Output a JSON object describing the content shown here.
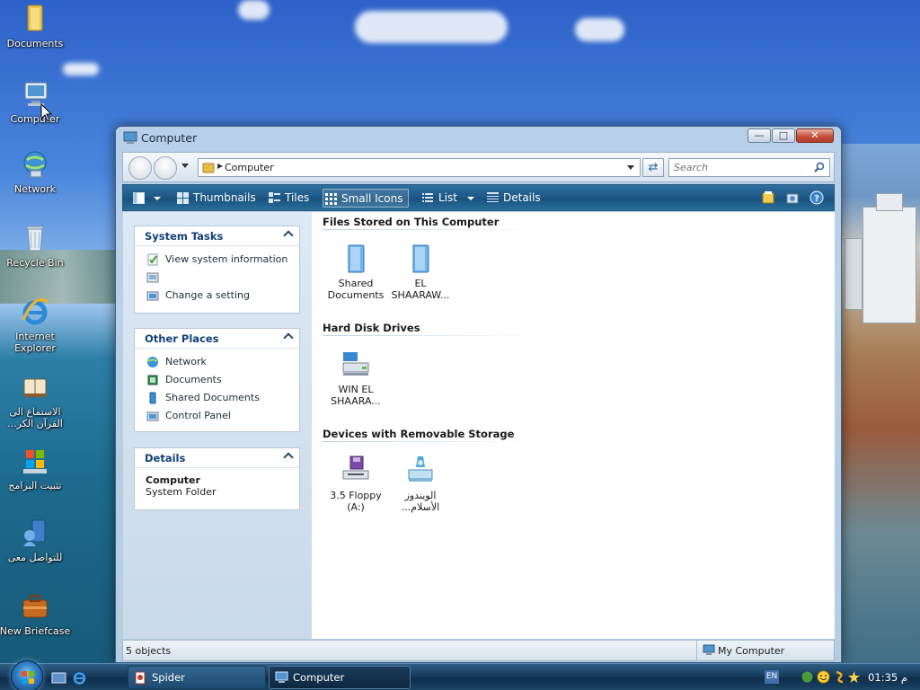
{
  "desktop": {
    "icons": [
      {
        "label": "Documents",
        "icon": "folder-icon"
      },
      {
        "label": "Computer",
        "icon": "computer-icon"
      },
      {
        "label": "Network",
        "icon": "network-icon"
      },
      {
        "label": "Recycle Bin",
        "icon": "recycle-bin-icon"
      },
      {
        "label": "Internet Explorer",
        "icon": "internet-explorer-icon"
      },
      {
        "label": "الاستماع الى القرآن الكر...",
        "icon": "book-icon"
      },
      {
        "label": "تثبيت البرامج",
        "icon": "windows-installer-icon"
      },
      {
        "label": "للتواصل معى",
        "icon": "contact-icon"
      },
      {
        "label": "New Briefcase",
        "icon": "briefcase-icon"
      }
    ]
  },
  "window": {
    "title": "Computer",
    "address": {
      "crumb": "Computer",
      "search_placeholder": "Search"
    },
    "toolbar": {
      "thumbnails": "Thumbnails",
      "tiles": "Tiles",
      "small_icons": "Small Icons",
      "list": "List",
      "details": "Details"
    },
    "panels": {
      "system_tasks": {
        "title": "System Tasks",
        "items": [
          "View system information",
          "Change a setting"
        ]
      },
      "other_places": {
        "title": "Other Places",
        "items": [
          "Network",
          "Documents",
          "Shared Documents",
          "Control Panel"
        ]
      },
      "details": {
        "title": "Details",
        "name": "Computer",
        "type": "System Folder"
      }
    },
    "groups": [
      {
        "title": "Files Stored on This Computer",
        "items": [
          {
            "label": "Shared Documents",
            "icon": "folder-icon"
          },
          {
            "label": "EL SHAARAW...",
            "icon": "folder-icon"
          }
        ]
      },
      {
        "title": "Hard Disk Drives",
        "items": [
          {
            "label": "WIN EL SHAARA...",
            "icon": "hard-disk-icon"
          }
        ]
      },
      {
        "title": "Devices with Removable Storage",
        "items": [
          {
            "label": "3.5 Floppy (A:)",
            "icon": "floppy-drive-icon"
          },
          {
            "label": "الويندوز الأسلام...",
            "icon": "dvd-drive-icon"
          }
        ]
      }
    ],
    "status": {
      "objects": "5 objects",
      "location": "My Computer"
    }
  },
  "taskbar": {
    "tasks": [
      {
        "label": "Spider",
        "icon": "spider-solitaire-icon"
      },
      {
        "label": "Computer",
        "icon": "computer-icon"
      }
    ],
    "tray": {
      "language": "EN",
      "clock": "01:35 م"
    }
  },
  "colors": {
    "toolbar": "#1f5a89",
    "panel_title": "#11407a",
    "taskbar": "#163b5c"
  }
}
